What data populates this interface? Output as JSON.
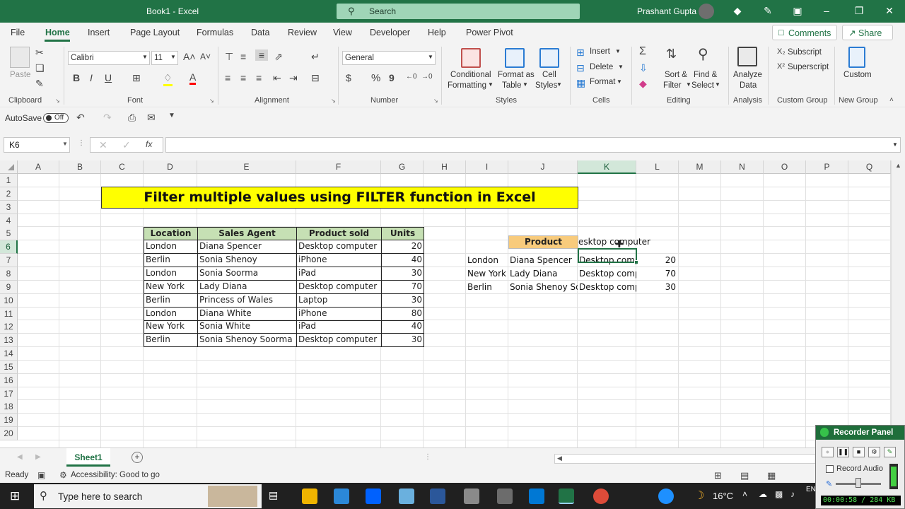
{
  "window": {
    "title": "Book1  -  Excel",
    "search_placeholder": "Search",
    "user": "Prashant Gupta"
  },
  "menu": {
    "tabs": [
      "File",
      "Home",
      "Insert",
      "Page Layout",
      "Formulas",
      "Data",
      "Review",
      "View",
      "Developer",
      "Help",
      "Power Pivot"
    ],
    "active": "Home",
    "comments": "Comments",
    "share": "Share"
  },
  "ribbon": {
    "clipboard": {
      "paste": "Paste",
      "label": "Clipboard"
    },
    "font": {
      "name": "Calibri",
      "size": "11",
      "label": "Font",
      "bold": "B",
      "italic": "I",
      "underline": "U",
      "color_letter": "A"
    },
    "alignment": {
      "label": "Alignment"
    },
    "number": {
      "format": "General",
      "label": "Number",
      "currency": "$",
      "percent": "%",
      "comma": "9"
    },
    "styles": {
      "conditional": "Conditional",
      "conditional2": "Formatting",
      "format_table": "Format as",
      "format_table2": "Table",
      "cell_styles": "Cell",
      "cell_styles2": "Styles",
      "label": "Styles"
    },
    "cells": {
      "insert": "Insert",
      "delete": "Delete",
      "format": "Format",
      "label": "Cells"
    },
    "editing": {
      "sum": "Σ",
      "sort": "Sort &",
      "sort2": "Filter",
      "find": "Find &",
      "find2": "Select",
      "label": "Editing"
    },
    "analysis": {
      "analyze": "Analyze",
      "analyze2": "Data",
      "label": "Analysis"
    },
    "custom": {
      "subscript": "Subscript",
      "superscript": "Superscript",
      "label": "Custom Group"
    },
    "newgroup": {
      "custom": "Custom",
      "label": "New Group"
    }
  },
  "qat": {
    "autosave": "AutoSave",
    "toggle": "Off"
  },
  "formula_bar": {
    "name_box": "K6",
    "fx": "fx",
    "formula": ""
  },
  "grid": {
    "columns": [
      "A",
      "B",
      "C",
      "D",
      "E",
      "F",
      "G",
      "H",
      "I",
      "J",
      "K",
      "L",
      "M",
      "N",
      "O",
      "P",
      "Q"
    ],
    "rows": [
      "1",
      "2",
      "3",
      "4",
      "5",
      "6",
      "7",
      "8",
      "9",
      "10",
      "11",
      "12",
      "13",
      "14",
      "15",
      "16",
      "17",
      "18",
      "19",
      "20"
    ],
    "selected_cell": "K6",
    "title": "Filter multiple values using FILTER function in Excel",
    "table_headers": [
      "Location",
      "Sales Agent",
      "Product sold",
      "Units"
    ],
    "table_rows": [
      [
        "London",
        "Diana Spencer",
        "Desktop computer",
        "20"
      ],
      [
        "Berlin",
        "Sonia Shenoy",
        "iPhone",
        "40"
      ],
      [
        "London",
        "Sonia Soorma",
        "iPad",
        "30"
      ],
      [
        "New York",
        "Lady Diana",
        "Desktop computer",
        "70"
      ],
      [
        "Berlin",
        "Princess of Wales",
        "Laptop",
        "30"
      ],
      [
        "London",
        "Diana White",
        "iPhone",
        "80"
      ],
      [
        "New York",
        "Sonia White",
        "iPad",
        "40"
      ],
      [
        "Berlin",
        "Sonia Shenoy Soorma",
        "Desktop computer",
        "30"
      ]
    ],
    "criteria_label": "Product",
    "criteria_value": "esktop computer",
    "result_rows": [
      [
        "London",
        "Diana Spencer",
        "Desktop comp",
        "20"
      ],
      [
        "New York",
        "Lady Diana",
        "Desktop comp",
        "70"
      ],
      [
        "Berlin",
        "Sonia Shenoy So",
        "Desktop comp",
        "30"
      ]
    ]
  },
  "sheets": {
    "active": "Sheet1"
  },
  "status": {
    "ready": "Ready",
    "accessibility": "Accessibility: Good to go"
  },
  "taskbar": {
    "search": "Type here to search",
    "temperature": "16°C",
    "lang": "EN"
  },
  "recorder": {
    "title": "Recorder Panel",
    "record_audio": "Record Audio",
    "time": "00:00:58 / 284 KB"
  },
  "colors": {
    "excel_green": "#217346",
    "title_yellow": "#ffff00",
    "header_green": "#c6e0b4",
    "criteria_orange": "#f8cb7c"
  }
}
